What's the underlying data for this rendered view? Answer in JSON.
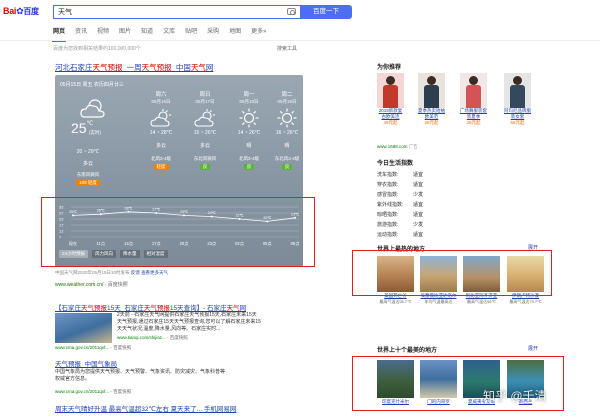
{
  "logo": {
    "text_left": "Bai",
    "text_right": "百度"
  },
  "search": {
    "query": "天气",
    "button": "百度一下"
  },
  "nav": {
    "tabs": [
      "网页",
      "资讯",
      "视频",
      "图片",
      "知道",
      "文库",
      "贴吧",
      "采购",
      "地图",
      "更多»"
    ],
    "active_index": 0
  },
  "result_info": "百度为您找到相关结果约100,000,000个",
  "search_tools": "搜索工具",
  "weather": {
    "title_prefix": "河北石家庄",
    "title_red1": "天气预报",
    "title_sep": "_一周",
    "title_red2": "天气预报",
    "title_suffix": "_中国",
    "title_red3": "天气",
    "title_end": "网",
    "date_line": "05月15日 周五 农历四月廿三",
    "current_temp": "25",
    "current_unit": "℃",
    "realtime": "(实时)",
    "today": {
      "range": "20 ~ 29℃",
      "cond": "多云",
      "wind": "东南风微风",
      "aqi_value": "109",
      "aqi_label": "轻度"
    },
    "days": [
      {
        "name": "周六",
        "date": "05月16日",
        "range": "14 ~ 28℃",
        "cond": "多云",
        "wind": "北风3-4级",
        "aqi": "轻度",
        "aqi_color": "orange"
      },
      {
        "name": "周日",
        "date": "05月17日",
        "range": "15 ~ 26℃",
        "cond": "多云",
        "wind": "东北风微风",
        "aqi": "良",
        "aqi_color": "green"
      },
      {
        "name": "周一",
        "date": "05月18日",
        "range": "14 ~ 26℃",
        "cond": "晴",
        "wind": "北风3-4级",
        "aqi": "良",
        "aqi_color": "green"
      },
      {
        "name": "周二",
        "date": "05月19日",
        "range": "16 ~ 26℃",
        "cond": "晴",
        "wind": "东北风3-4级",
        "aqi": "良",
        "aqi_color": "green"
      }
    ],
    "chart_tabs": [
      "24小时预报",
      "风力风向",
      "降水量",
      "相对湿度"
    ],
    "source_line": "中国天气网2020年05月15日10时发布",
    "source_link1": "反馈",
    "source_link2": "查看更多天气",
    "url": "www.weather.com.cn/",
    "snapshot": "- 百度快照"
  },
  "chart_data": {
    "type": "line",
    "title": "",
    "x": [
      "现在",
      "11点",
      "14点",
      "17点",
      "20点",
      "23点",
      "02点",
      "05点",
      "08点"
    ],
    "series": [
      {
        "values": [
          25,
          26,
          28,
          27,
          25,
          24,
          22,
          20,
          23
        ]
      }
    ],
    "point_labels": [
      "25℃",
      "26℃",
      "28℃",
      "27℃",
      "25℃",
      "24℃",
      "22℃",
      "20℃",
      "23℃"
    ],
    "ylabels": [
      "32",
      "27",
      "22",
      "17",
      "12",
      "7"
    ],
    "ylim": [
      7,
      32
    ],
    "grid": true
  },
  "results": [
    {
      "title_parts": [
        "【石家庄",
        "天气预报",
        "15天_石家庄",
        "天气预报",
        "15天查询】- 石家庄",
        "天气",
        "网"
      ],
      "text_lines": [
        "2天前 - 石家庄天气网提供石家庄天气预报15天,石家庄未来15天",
        "天气预报,通过石家庄15天天气预报查询,您可以了解石家庄未来15",
        "天天气状况,温度,降水量,风向等。石家庄实时..."
      ],
      "url": "www.tianqi.com/shijiaz...",
      "snapshot": "- 百度快照",
      "pre_url": "www.cma.gov.cn/2011qxf...",
      "pre_snap": "- 百度快照"
    },
    {
      "title": "天气预报_中国气象局",
      "text_lines": [
        "中国气象局为您提供天气预报、天气预警、气象资讯、防灾减灾、气象科普等",
        "权威官方信息。"
      ],
      "url": "www.cma.gov.cn/2011qxf...",
      "snapshot": "- 百度快照"
    },
    {
      "title": "周末天气晴好升温 最高气温超32℃左右 夏天来了... 手机网易网"
    }
  ],
  "right_panel": {
    "products_title": "为你推荐",
    "products": [
      {
        "label": "2019新款复古欧美连",
        "price": "49元起"
      },
      {
        "label": "夏季热卖短袖欧美范",
        "price": "28元起"
      },
      {
        "label": "广场舞服装套装夏季",
        "price": "26元起"
      },
      {
        "label": "阿玛尼品牌服装女套",
        "price": "56元起"
      }
    ],
    "products_src": "www.1688.com",
    "products_ad": "广告",
    "life_title": "今日生活指数",
    "life": [
      {
        "k": "洗车指数:",
        "v": "适宜"
      },
      {
        "k": "穿衣指数:",
        "v": "适宜"
      },
      {
        "k": "感冒指数:",
        "v": "少发"
      },
      {
        "k": "紫外线指数:",
        "v": "适宜"
      },
      {
        "k": "晾晒指数:",
        "v": "适宜"
      },
      {
        "k": "旅游指数:",
        "v": "少发"
      },
      {
        "k": "运动指数:",
        "v": "适宜"
      }
    ],
    "hot_title": "世界上最热的地方",
    "hot_more": "展开",
    "hot": [
      {
        "label": "美国死亡谷",
        "desc": "最高气温达56.7℃"
      },
      {
        "label": "埃塞俄比亚达洛尔",
        "desc": "年均气温最高达"
      },
      {
        "label": "利比亚阿齐济亚",
        "desc": "最高气温达58℃"
      },
      {
        "label": "伊朗卢特沙漠",
        "desc": "最高气温达70.7℃"
      }
    ],
    "dream_title": "世界上十个最美的地方",
    "dream_more": "展开",
    "dream": [
      {
        "label": "印度克什米尔"
      },
      {
        "label": "门的内哥罗"
      },
      {
        "label": "夏威夷考艾岛"
      },
      {
        "label": "新西兰"
      }
    ],
    "watermark": "知乎 @千清"
  },
  "colors": {
    "brand_blue": "#4e6ef2",
    "link": "#2440b3",
    "highlight_red": "#c00",
    "url_green": "#008000",
    "annotation_red": "#e02020"
  }
}
